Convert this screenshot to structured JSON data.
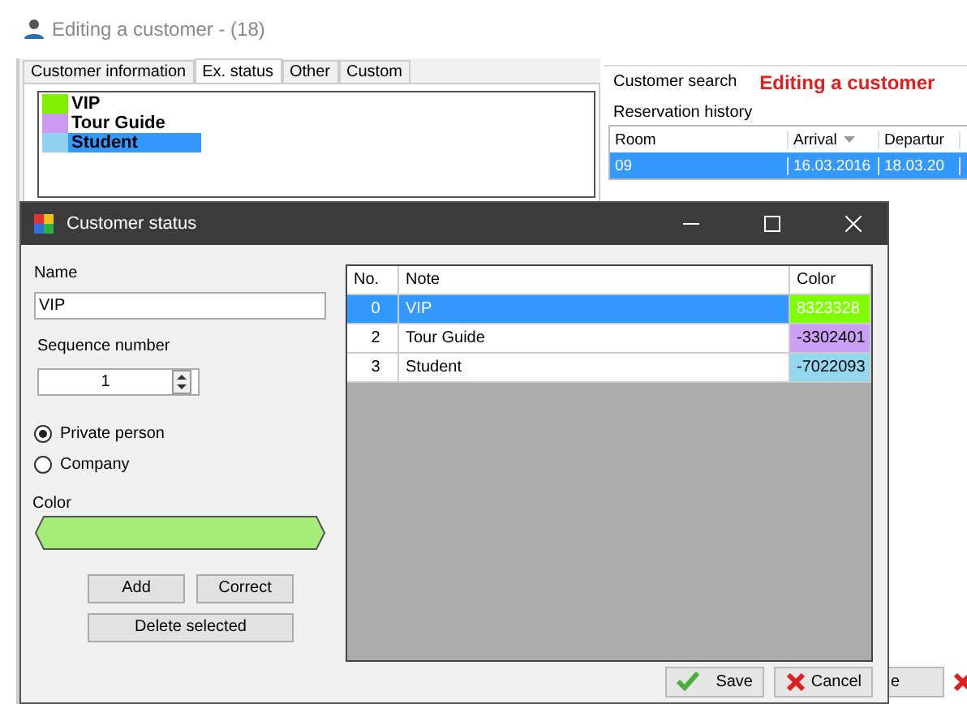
{
  "window": {
    "title": "Editing a customer - (18)"
  },
  "tabs": [
    {
      "label": "Customer information",
      "selected": false
    },
    {
      "label": "Ex. status",
      "selected": true
    },
    {
      "label": "Other",
      "selected": false
    },
    {
      "label": "Custom",
      "selected": false
    }
  ],
  "statuses": [
    {
      "label": "VIP",
      "color": "#80f000",
      "selected": false
    },
    {
      "label": "Tour Guide",
      "color": "#cc99f0",
      "selected": false
    },
    {
      "label": "Student",
      "color": "#90d0f0",
      "selected": true
    }
  ],
  "customer_search": {
    "label": "Customer search",
    "heading": "Editing a customer"
  },
  "reservation_history": {
    "label": "Reservation history",
    "columns": [
      "Room",
      "Arrival",
      "Departur"
    ],
    "rows": [
      {
        "cells": [
          "09",
          "16.03.2016",
          "18.03.20"
        ],
        "selected": true
      }
    ]
  },
  "background_button": {
    "label": "e"
  },
  "dialog": {
    "title": "Customer status",
    "name_label": "Name",
    "name_value": "VIP",
    "sequence_label": "Sequence number",
    "sequence_value": "1",
    "radios": [
      {
        "label": "Private person",
        "selected": true
      },
      {
        "label": "Company",
        "selected": false
      }
    ],
    "color_label": "Color",
    "color": "#a4ee78",
    "buttons": [
      "Add",
      "Correct",
      "Delete selected"
    ],
    "grid": {
      "columns": [
        "No.",
        "Note",
        "Color"
      ],
      "rows": [
        {
          "no": "0",
          "note": "VIP",
          "value": "8323328",
          "color": "#80ff00",
          "selected": true
        },
        {
          "no": "2",
          "note": "Tour Guide",
          "value": "-3302401",
          "color": "#cda0f8",
          "selected": false
        },
        {
          "no": "3",
          "note": "Student",
          "value": "-7022093",
          "color": "#94d8f0",
          "selected": false
        }
      ]
    },
    "save": "Save",
    "cancel": "Cancel"
  }
}
